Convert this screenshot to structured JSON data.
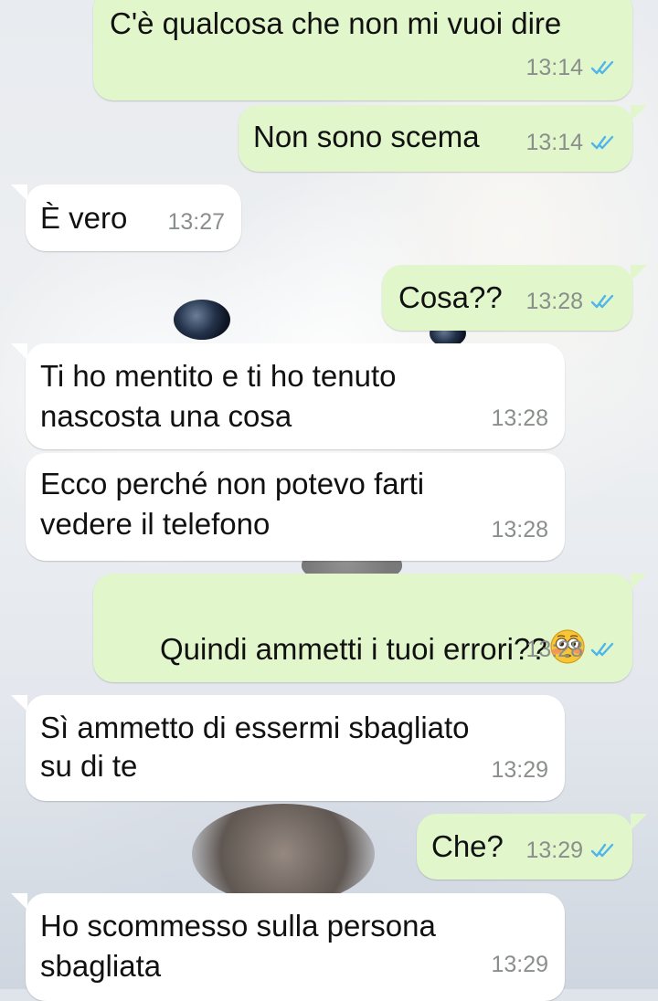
{
  "chat": {
    "messages": [
      {
        "direction": "outgoing",
        "text": "C'è qualcosa che non mi vuoi dire",
        "time": "13:14",
        "status": "read"
      },
      {
        "direction": "outgoing",
        "text": "Non sono scema",
        "time": "13:14",
        "status": "read"
      },
      {
        "direction": "incoming",
        "text": "È vero",
        "time": "13:27"
      },
      {
        "direction": "outgoing",
        "text": "Cosa??",
        "time": "13:28",
        "status": "read"
      },
      {
        "direction": "incoming",
        "text_line1": "Ti ho mentito e ti ho tenuto",
        "text_line2": "nascosta una cosa",
        "time": "13:28"
      },
      {
        "direction": "incoming",
        "text_line1": "Ecco perché non potevo farti",
        "text_line2": "vedere il telefono",
        "time": "13:28"
      },
      {
        "direction": "outgoing",
        "text": "Quindi ammetti i tuoi errori??",
        "emoji": "flushed-face-emoji",
        "time": "13:28",
        "status": "read"
      },
      {
        "direction": "incoming",
        "text_line1": "Sì ammetto di essermi sbagliato",
        "text_line2": "su di te",
        "time": "13:29"
      },
      {
        "direction": "outgoing",
        "text": "Che?",
        "time": "13:29",
        "status": "read"
      },
      {
        "direction": "incoming",
        "text_line1": "Ho scommesso sulla persona",
        "text_line2": "sbagliata",
        "time": "13:29"
      }
    ]
  },
  "theme": {
    "outgoing_bubble": "#e1f7cb",
    "incoming_bubble": "#ffffff",
    "read_tick_color": "#4fb6ec",
    "timestamp_color": "#8a8f8b",
    "icons": {
      "read_receipt": "double-check-icon",
      "emoji": "flushed-face-emoji"
    }
  }
}
